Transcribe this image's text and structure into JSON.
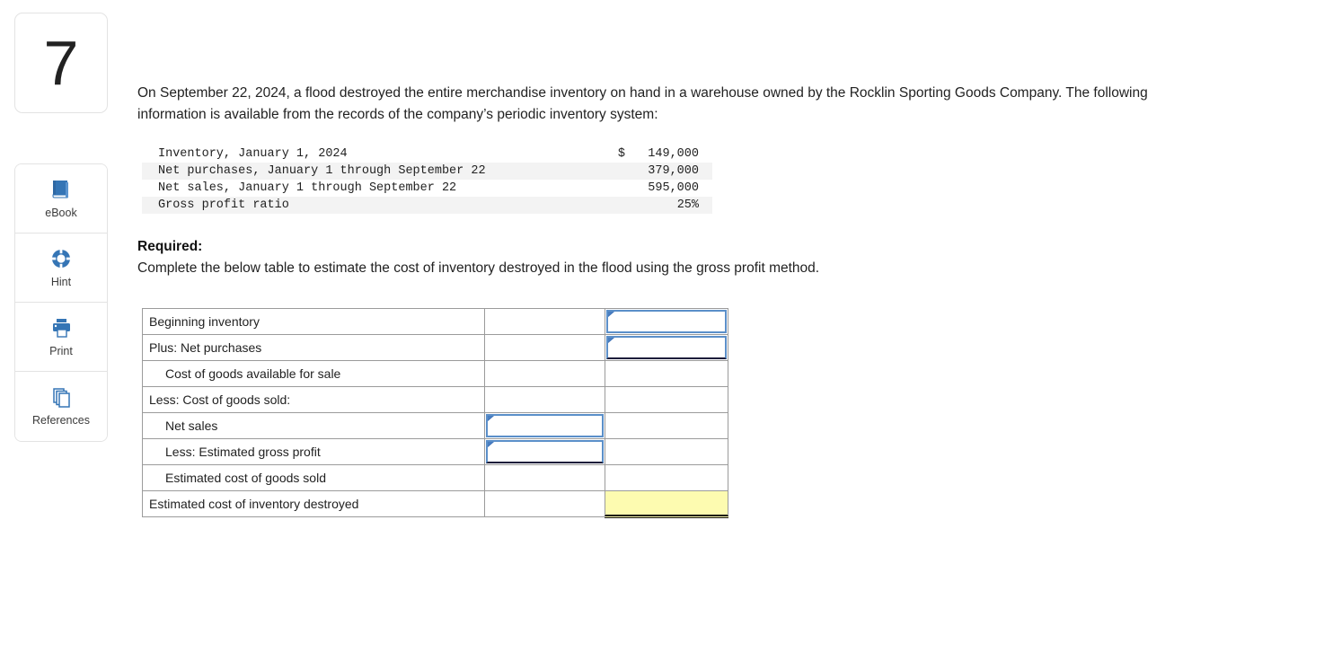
{
  "question": {
    "number": "7",
    "prompt": "On September 22, 2024, a flood destroyed the entire merchandise inventory on hand in a warehouse owned by the Rocklin Sporting Goods Company. The following information is available from the records of the company’s periodic inventory system:",
    "required_label": "Required:",
    "required_text": "Complete the below table to estimate the cost of inventory destroyed in the flood using the gross profit method."
  },
  "tools": [
    {
      "label": "eBook",
      "icon": "ebook-icon"
    },
    {
      "label": "Hint",
      "icon": "lifebuoy-icon"
    },
    {
      "label": "Print",
      "icon": "printer-icon"
    },
    {
      "label": "References",
      "icon": "references-icon"
    }
  ],
  "facts": {
    "rows": [
      {
        "label": "Inventory, January 1, 2024",
        "symbol": "$",
        "value": "149,000"
      },
      {
        "label": "Net purchases, January 1 through September 22",
        "symbol": "",
        "value": "379,000"
      },
      {
        "label": "Net sales, January 1 through September 22",
        "symbol": "",
        "value": "595,000"
      },
      {
        "label": "Gross profit ratio",
        "symbol": "",
        "value": "25%"
      }
    ]
  },
  "answer_table": {
    "rows": [
      {
        "label": "Beginning inventory",
        "indent": false,
        "col2": "",
        "col3": "",
        "col2_input": false,
        "col3_input": true
      },
      {
        "label": "Plus: Net purchases",
        "indent": false,
        "col2": "",
        "col3": "",
        "col2_input": false,
        "col3_input": true
      },
      {
        "label": "Cost of goods available for sale",
        "indent": true,
        "col2": "",
        "col3": "",
        "col2_input": false,
        "col3_input": false
      },
      {
        "label": "Less: Cost of goods sold:",
        "indent": false,
        "col2": "",
        "col3": "",
        "col2_input": false,
        "col3_input": false
      },
      {
        "label": "Net sales",
        "indent": true,
        "col2": "",
        "col3": "",
        "col2_input": true,
        "col3_input": false
      },
      {
        "label": "Less: Estimated gross profit",
        "indent": true,
        "col2": "",
        "col3": "",
        "col2_input": true,
        "col3_input": false
      },
      {
        "label": "Estimated cost of goods sold",
        "indent": true,
        "col2": "",
        "col3": "",
        "col2_input": false,
        "col3_input": false
      },
      {
        "label": "Estimated cost of inventory destroyed",
        "indent": false,
        "col2": "",
        "col3": "",
        "col2_input": false,
        "col3_input": false,
        "highlight": true
      }
    ]
  },
  "colors": {
    "accent_blue": "#3575b5",
    "input_border": "#5b8fc9",
    "highlight_yellow": "#fdfbb0",
    "stripe_gray": "#f3f3f3"
  }
}
